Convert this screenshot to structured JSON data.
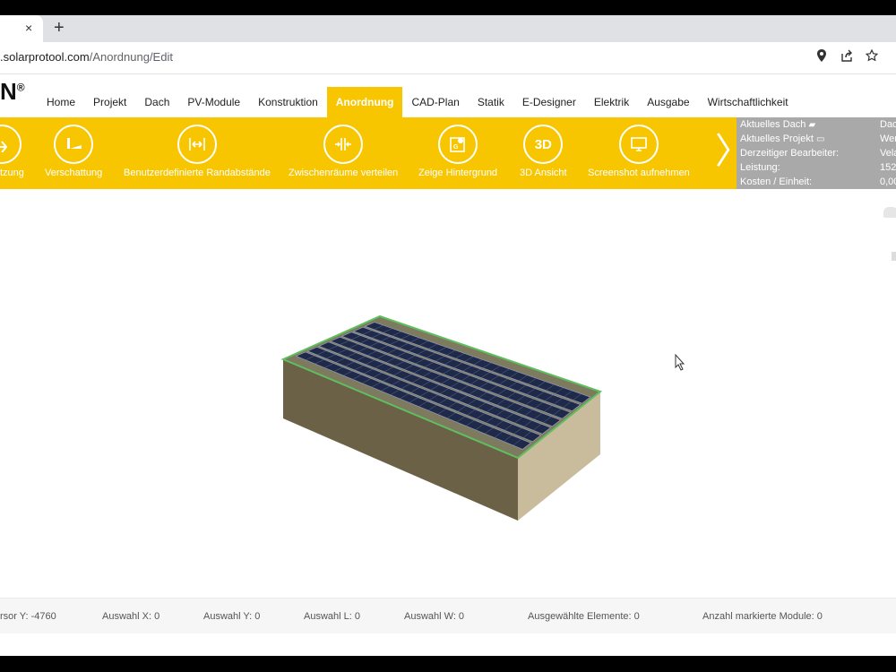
{
  "browser": {
    "close_tab": "×",
    "new_tab": "+",
    "url_host": ".solarprotool.com",
    "url_path": "/Anordnung/Edit",
    "icons": [
      "location-icon",
      "share-icon",
      "star-icon"
    ]
  },
  "app": {
    "logo_text": "N",
    "logo_mark": "®",
    "nav": [
      "Home",
      "Projekt",
      "Dach",
      "PV-Module",
      "Konstruktion",
      "Anordnung",
      "CAD-Plan",
      "Statik",
      "E-Designer",
      "Elektrik",
      "Ausgabe",
      "Wirtschaftlichkeit"
    ],
    "active_nav": "Anordnung"
  },
  "ribbon": {
    "buttons": [
      {
        "label": "tzung",
        "icon": "arrow-icon"
      },
      {
        "label": "Verschattung",
        "icon": "shading-icon"
      },
      {
        "label": "Benutzerdefinierte Randabstände",
        "icon": "margin-icon"
      },
      {
        "label": "Zwischenräume verteilen",
        "icon": "spacing-icon"
      },
      {
        "label": "Zeige Hintergrund",
        "icon": "background-icon"
      },
      {
        "label": "3D Ansicht",
        "icon": "3d-icon",
        "glyph": "3D"
      },
      {
        "label": "Screenshot aufnehmen",
        "icon": "monitor-icon"
      }
    ],
    "next": "〉"
  },
  "info": {
    "rows": [
      {
        "label": "Aktuelles Dach",
        "value": "Dac"
      },
      {
        "label": "Aktuelles Projekt",
        "value": "Wer"
      },
      {
        "label": "Derzeitiger Bearbeiter:",
        "value": "Vela"
      },
      {
        "label": "Leistung:",
        "value": "152"
      },
      {
        "label": "Kosten / Einheit:",
        "value": "0,00"
      }
    ]
  },
  "status": {
    "cursor_y": "rsor Y:  -4760",
    "auswahl_x": "Auswahl X:  0",
    "auswahl_y": "Auswahl Y:  0",
    "auswahl_l": "Auswahl L:  0",
    "auswahl_w": "Auswahl W:  0",
    "ausgewaehlte": "Ausgewählte Elemente:  0",
    "markierte": "Anzahl markierte Module:  0"
  },
  "colors": {
    "accent": "#f7c600",
    "panel": "#1f2a4a",
    "building_front": "#6b6146",
    "building_side": "#c8bc9d",
    "roof_border": "#5fbf5f"
  }
}
